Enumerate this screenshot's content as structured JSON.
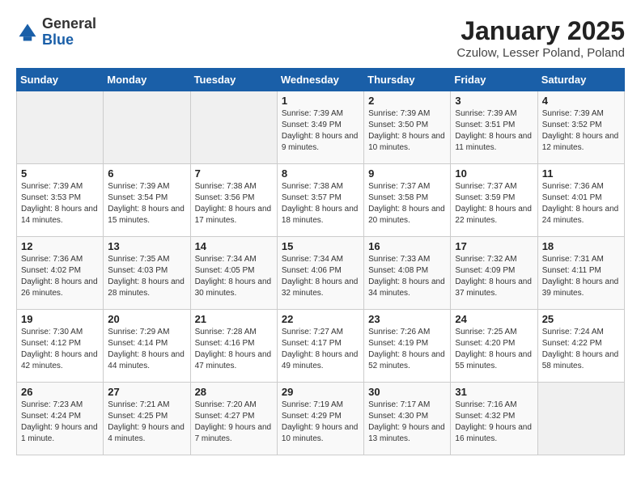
{
  "header": {
    "logo_general": "General",
    "logo_blue": "Blue",
    "title": "January 2025",
    "subtitle": "Czulow, Lesser Poland, Poland"
  },
  "weekdays": [
    "Sunday",
    "Monday",
    "Tuesday",
    "Wednesday",
    "Thursday",
    "Friday",
    "Saturday"
  ],
  "weeks": [
    [
      {
        "day": "",
        "sunrise": "",
        "sunset": "",
        "daylight": ""
      },
      {
        "day": "",
        "sunrise": "",
        "sunset": "",
        "daylight": ""
      },
      {
        "day": "",
        "sunrise": "",
        "sunset": "",
        "daylight": ""
      },
      {
        "day": "1",
        "sunrise": "Sunrise: 7:39 AM",
        "sunset": "Sunset: 3:49 PM",
        "daylight": "Daylight: 8 hours and 9 minutes."
      },
      {
        "day": "2",
        "sunrise": "Sunrise: 7:39 AM",
        "sunset": "Sunset: 3:50 PM",
        "daylight": "Daylight: 8 hours and 10 minutes."
      },
      {
        "day": "3",
        "sunrise": "Sunrise: 7:39 AM",
        "sunset": "Sunset: 3:51 PM",
        "daylight": "Daylight: 8 hours and 11 minutes."
      },
      {
        "day": "4",
        "sunrise": "Sunrise: 7:39 AM",
        "sunset": "Sunset: 3:52 PM",
        "daylight": "Daylight: 8 hours and 12 minutes."
      }
    ],
    [
      {
        "day": "5",
        "sunrise": "Sunrise: 7:39 AM",
        "sunset": "Sunset: 3:53 PM",
        "daylight": "Daylight: 8 hours and 14 minutes."
      },
      {
        "day": "6",
        "sunrise": "Sunrise: 7:39 AM",
        "sunset": "Sunset: 3:54 PM",
        "daylight": "Daylight: 8 hours and 15 minutes."
      },
      {
        "day": "7",
        "sunrise": "Sunrise: 7:38 AM",
        "sunset": "Sunset: 3:56 PM",
        "daylight": "Daylight: 8 hours and 17 minutes."
      },
      {
        "day": "8",
        "sunrise": "Sunrise: 7:38 AM",
        "sunset": "Sunset: 3:57 PM",
        "daylight": "Daylight: 8 hours and 18 minutes."
      },
      {
        "day": "9",
        "sunrise": "Sunrise: 7:37 AM",
        "sunset": "Sunset: 3:58 PM",
        "daylight": "Daylight: 8 hours and 20 minutes."
      },
      {
        "day": "10",
        "sunrise": "Sunrise: 7:37 AM",
        "sunset": "Sunset: 3:59 PM",
        "daylight": "Daylight: 8 hours and 22 minutes."
      },
      {
        "day": "11",
        "sunrise": "Sunrise: 7:36 AM",
        "sunset": "Sunset: 4:01 PM",
        "daylight": "Daylight: 8 hours and 24 minutes."
      }
    ],
    [
      {
        "day": "12",
        "sunrise": "Sunrise: 7:36 AM",
        "sunset": "Sunset: 4:02 PM",
        "daylight": "Daylight: 8 hours and 26 minutes."
      },
      {
        "day": "13",
        "sunrise": "Sunrise: 7:35 AM",
        "sunset": "Sunset: 4:03 PM",
        "daylight": "Daylight: 8 hours and 28 minutes."
      },
      {
        "day": "14",
        "sunrise": "Sunrise: 7:34 AM",
        "sunset": "Sunset: 4:05 PM",
        "daylight": "Daylight: 8 hours and 30 minutes."
      },
      {
        "day": "15",
        "sunrise": "Sunrise: 7:34 AM",
        "sunset": "Sunset: 4:06 PM",
        "daylight": "Daylight: 8 hours and 32 minutes."
      },
      {
        "day": "16",
        "sunrise": "Sunrise: 7:33 AM",
        "sunset": "Sunset: 4:08 PM",
        "daylight": "Daylight: 8 hours and 34 minutes."
      },
      {
        "day": "17",
        "sunrise": "Sunrise: 7:32 AM",
        "sunset": "Sunset: 4:09 PM",
        "daylight": "Daylight: 8 hours and 37 minutes."
      },
      {
        "day": "18",
        "sunrise": "Sunrise: 7:31 AM",
        "sunset": "Sunset: 4:11 PM",
        "daylight": "Daylight: 8 hours and 39 minutes."
      }
    ],
    [
      {
        "day": "19",
        "sunrise": "Sunrise: 7:30 AM",
        "sunset": "Sunset: 4:12 PM",
        "daylight": "Daylight: 8 hours and 42 minutes."
      },
      {
        "day": "20",
        "sunrise": "Sunrise: 7:29 AM",
        "sunset": "Sunset: 4:14 PM",
        "daylight": "Daylight: 8 hours and 44 minutes."
      },
      {
        "day": "21",
        "sunrise": "Sunrise: 7:28 AM",
        "sunset": "Sunset: 4:16 PM",
        "daylight": "Daylight: 8 hours and 47 minutes."
      },
      {
        "day": "22",
        "sunrise": "Sunrise: 7:27 AM",
        "sunset": "Sunset: 4:17 PM",
        "daylight": "Daylight: 8 hours and 49 minutes."
      },
      {
        "day": "23",
        "sunrise": "Sunrise: 7:26 AM",
        "sunset": "Sunset: 4:19 PM",
        "daylight": "Daylight: 8 hours and 52 minutes."
      },
      {
        "day": "24",
        "sunrise": "Sunrise: 7:25 AM",
        "sunset": "Sunset: 4:20 PM",
        "daylight": "Daylight: 8 hours and 55 minutes."
      },
      {
        "day": "25",
        "sunrise": "Sunrise: 7:24 AM",
        "sunset": "Sunset: 4:22 PM",
        "daylight": "Daylight: 8 hours and 58 minutes."
      }
    ],
    [
      {
        "day": "26",
        "sunrise": "Sunrise: 7:23 AM",
        "sunset": "Sunset: 4:24 PM",
        "daylight": "Daylight: 9 hours and 1 minute."
      },
      {
        "day": "27",
        "sunrise": "Sunrise: 7:21 AM",
        "sunset": "Sunset: 4:25 PM",
        "daylight": "Daylight: 9 hours and 4 minutes."
      },
      {
        "day": "28",
        "sunrise": "Sunrise: 7:20 AM",
        "sunset": "Sunset: 4:27 PM",
        "daylight": "Daylight: 9 hours and 7 minutes."
      },
      {
        "day": "29",
        "sunrise": "Sunrise: 7:19 AM",
        "sunset": "Sunset: 4:29 PM",
        "daylight": "Daylight: 9 hours and 10 minutes."
      },
      {
        "day": "30",
        "sunrise": "Sunrise: 7:17 AM",
        "sunset": "Sunset: 4:30 PM",
        "daylight": "Daylight: 9 hours and 13 minutes."
      },
      {
        "day": "31",
        "sunrise": "Sunrise: 7:16 AM",
        "sunset": "Sunset: 4:32 PM",
        "daylight": "Daylight: 9 hours and 16 minutes."
      },
      {
        "day": "",
        "sunrise": "",
        "sunset": "",
        "daylight": ""
      }
    ]
  ]
}
